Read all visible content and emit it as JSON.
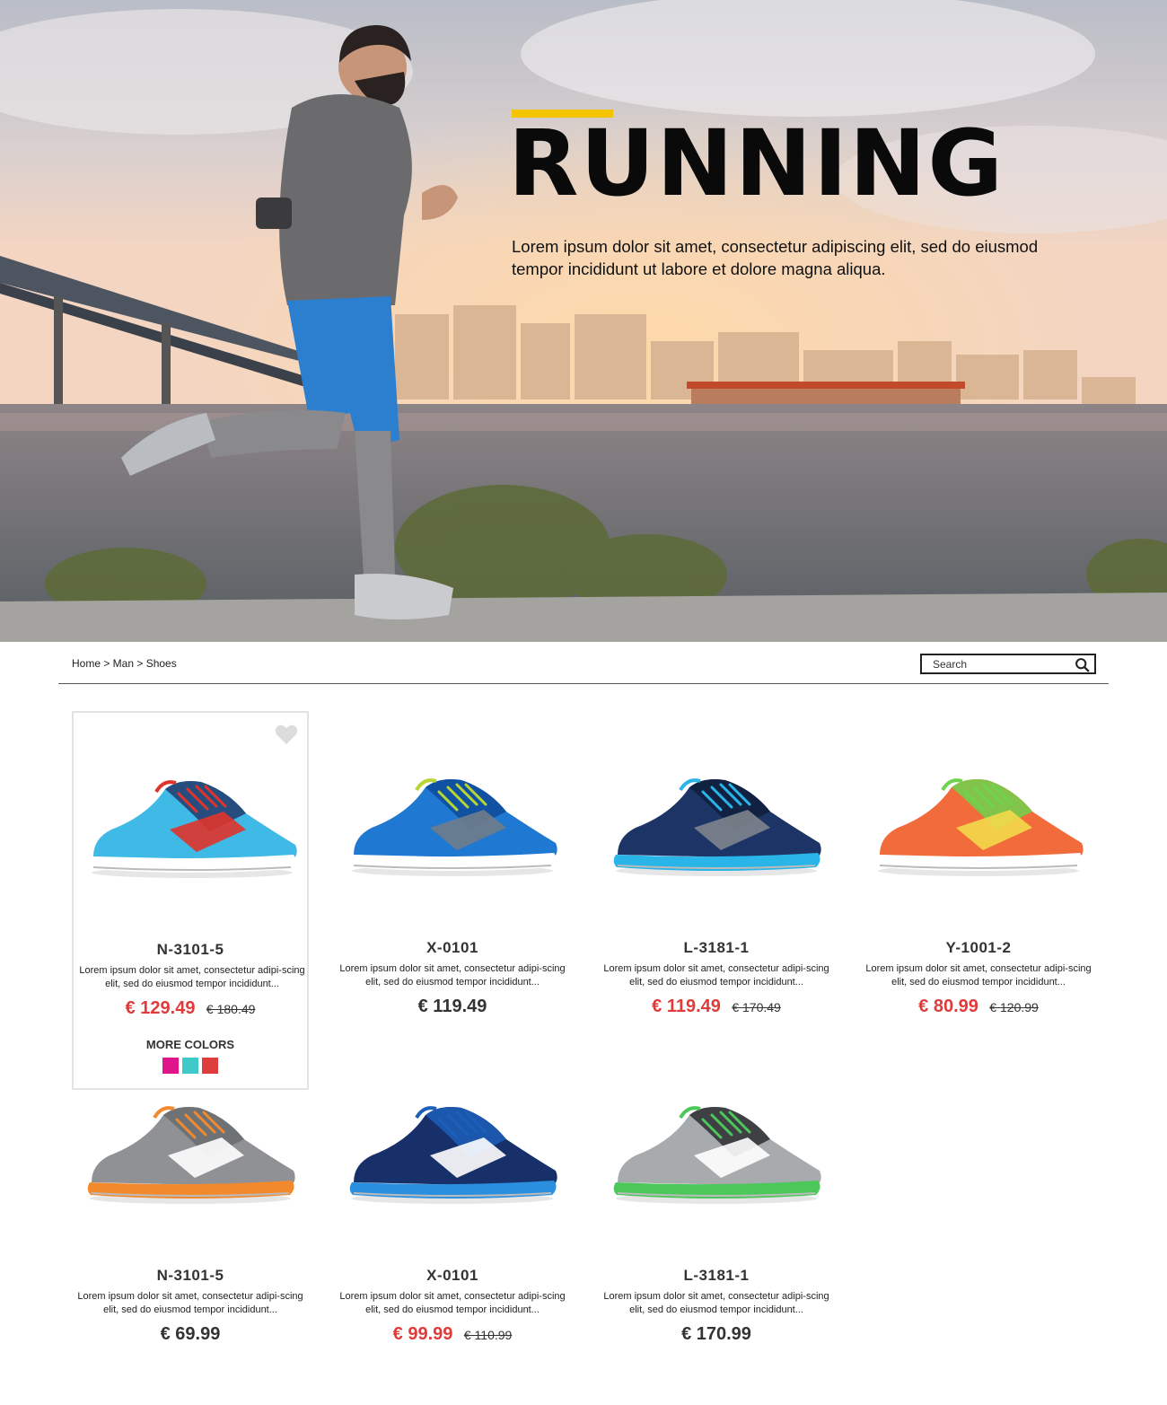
{
  "hero": {
    "title": "RUNNING",
    "text": "Lorem ipsum dolor sit amet, consectetur adipiscing elit, sed do eiusmod tempor incididunt ut labore et dolore magna aliqua.",
    "accent_color": "#f5c400"
  },
  "breadcrumb": "Home > Man > Shoes",
  "search": {
    "placeholder": "Search",
    "icon": "search-icon"
  },
  "more_colors_label": "MORE COLORS",
  "products": [
    {
      "name": "N-3101-5",
      "desc": "Lorem ipsum dolor sit amet, consectetur adipi-scing elit, sed do eiusmod tempor incididunt...",
      "price": "€ 129.49",
      "old_price": "€ 180.49",
      "sale": true,
      "colors": {
        "upper": "#3fb9e6",
        "accent": "#e0342b",
        "dark": "#233a6b",
        "sole": "#ffffff",
        "lace": "#e0342b"
      }
    },
    {
      "name": "X-0101",
      "desc": "Lorem ipsum dolor sit amet, consectetur adipi-scing elit, sed do eiusmod tempor incididunt...",
      "price": "€ 119.49",
      "old_price": "",
      "sale": false,
      "colors": {
        "upper": "#1f78d1",
        "accent": "#6f7c8a",
        "dark": "#0e4a9a",
        "sole": "#ffffff",
        "lace": "#b9d534"
      }
    },
    {
      "name": "L-3181-1",
      "desc": "Lorem ipsum dolor sit amet, consectetur adipi-scing elit, sed do eiusmod tempor incididunt...",
      "price": "€ 119.49",
      "old_price": "€ 170.49",
      "sale": true,
      "colors": {
        "upper": "#1d3566",
        "accent": "#7d848c",
        "dark": "#0e1d3c",
        "sole": "#29b5e8",
        "lace": "#29b5e8"
      }
    },
    {
      "name": "Y-1001-2",
      "desc": "Lorem ipsum dolor sit amet, consectetur adipi-scing elit, sed do eiusmod tempor incididunt...",
      "price": "€ 80.99",
      "old_price": "€ 120.99",
      "sale": true,
      "colors": {
        "upper": "#f26b3a",
        "accent": "#f3d94a",
        "dark": "#6ed34d",
        "sole": "#ffffff",
        "lace": "#6ed34d"
      }
    },
    {
      "name": "N-3101-5",
      "desc": "Lorem ipsum dolor sit amet, consectetur adipi-scing elit, sed do eiusmod tempor incididunt...",
      "price": "€ 69.99",
      "old_price": "",
      "sale": false,
      "colors": {
        "upper": "#8f9194",
        "accent": "#ffffff",
        "dark": "#6a6c70",
        "sole": "#f28a2d",
        "lace": "#f28a2d"
      }
    },
    {
      "name": "X-0101",
      "desc": "Lorem ipsum dolor sit amet, consectetur adipi-scing elit, sed do eiusmod tempor incididunt...",
      "price": "€ 99.99",
      "old_price": "€ 110.99",
      "sale": true,
      "colors": {
        "upper": "#17306a",
        "accent": "#ffffff",
        "dark": "#1c5fb8",
        "sole": "#2b8fe0",
        "lace": "#1c5fb8"
      }
    },
    {
      "name": "L-3181-1",
      "desc": "Lorem ipsum dolor sit amet, consectetur adipi-scing elit, sed do eiusmod tempor incididunt...",
      "price": "€ 170.99",
      "old_price": "",
      "sale": false,
      "colors": {
        "upper": "#a8abae",
        "accent": "#ffffff",
        "dark": "#2b2d30",
        "sole": "#4cc85a",
        "lace": "#4cc85a"
      }
    }
  ],
  "featured_swatches": [
    "#e0158a",
    "#3fc9c9",
    "#de3d3d"
  ],
  "colors": {
    "sale": "#e03a3a",
    "text": "#333333",
    "card_border": "#e3e3e3"
  }
}
